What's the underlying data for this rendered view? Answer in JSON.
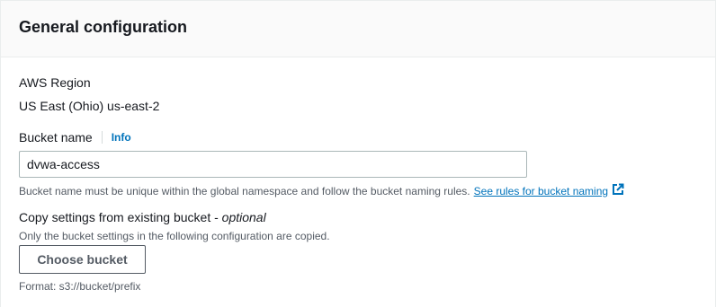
{
  "panel": {
    "title": "General configuration"
  },
  "region": {
    "label": "AWS Region",
    "value": "US East (Ohio) us-east-2"
  },
  "bucket_name": {
    "label": "Bucket name",
    "info_link": "Info",
    "value": "dvwa-access",
    "hint": "Bucket name must be unique within the global namespace and follow the bucket naming rules.",
    "rules_link": "See rules for bucket naming"
  },
  "copy_settings": {
    "label": "Copy settings from existing bucket - ",
    "label_optional": "optional",
    "hint": "Only the bucket settings in the following configuration are copied.",
    "button_label": "Choose bucket",
    "format_hint": "Format: s3://bucket/prefix"
  },
  "colors": {
    "link": "#0073bb",
    "text": "#16191f",
    "secondary_text": "#545b64",
    "header_bg": "#fafafa"
  },
  "icons": {
    "external_link": "external-link-icon"
  }
}
